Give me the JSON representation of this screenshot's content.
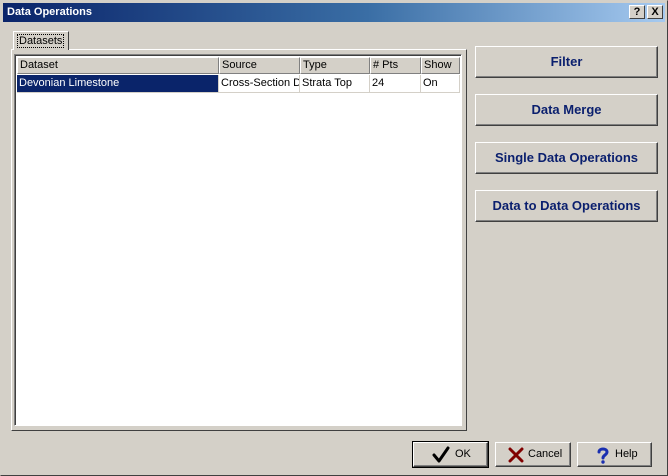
{
  "window": {
    "title": "Data Operations",
    "help_glyph": "?",
    "close_glyph": "X"
  },
  "tabs": [
    {
      "label": "Datasets",
      "active": true
    }
  ],
  "table": {
    "columns": [
      "Dataset",
      "Source",
      "Type",
      "# Pts",
      "Show"
    ],
    "rows": [
      {
        "dataset": "Devonian Limestone",
        "source": "Cross-Section Data",
        "type": "Strata Top",
        "pts": "24",
        "show": "On",
        "selected": true
      }
    ]
  },
  "side_buttons": {
    "filter": "Filter",
    "data_merge": "Data Merge",
    "single_ops": "Single Data Operations",
    "data_to_data": "Data to  Data Operations"
  },
  "footer_buttons": {
    "ok": {
      "label": "OK",
      "icon": "checkmark-icon"
    },
    "cancel": {
      "label": "Cancel",
      "icon": "x-mark-icon"
    },
    "help": {
      "label": "Help",
      "icon": "question-mark-icon"
    }
  },
  "colors": {
    "title_gradient_start": "#0a246a",
    "title_gradient_end": "#a6caf0",
    "selection": "#0a246a",
    "button_text": "#0a1f6e",
    "cancel_icon": "#800000",
    "help_icon": "#1a2fb0"
  }
}
